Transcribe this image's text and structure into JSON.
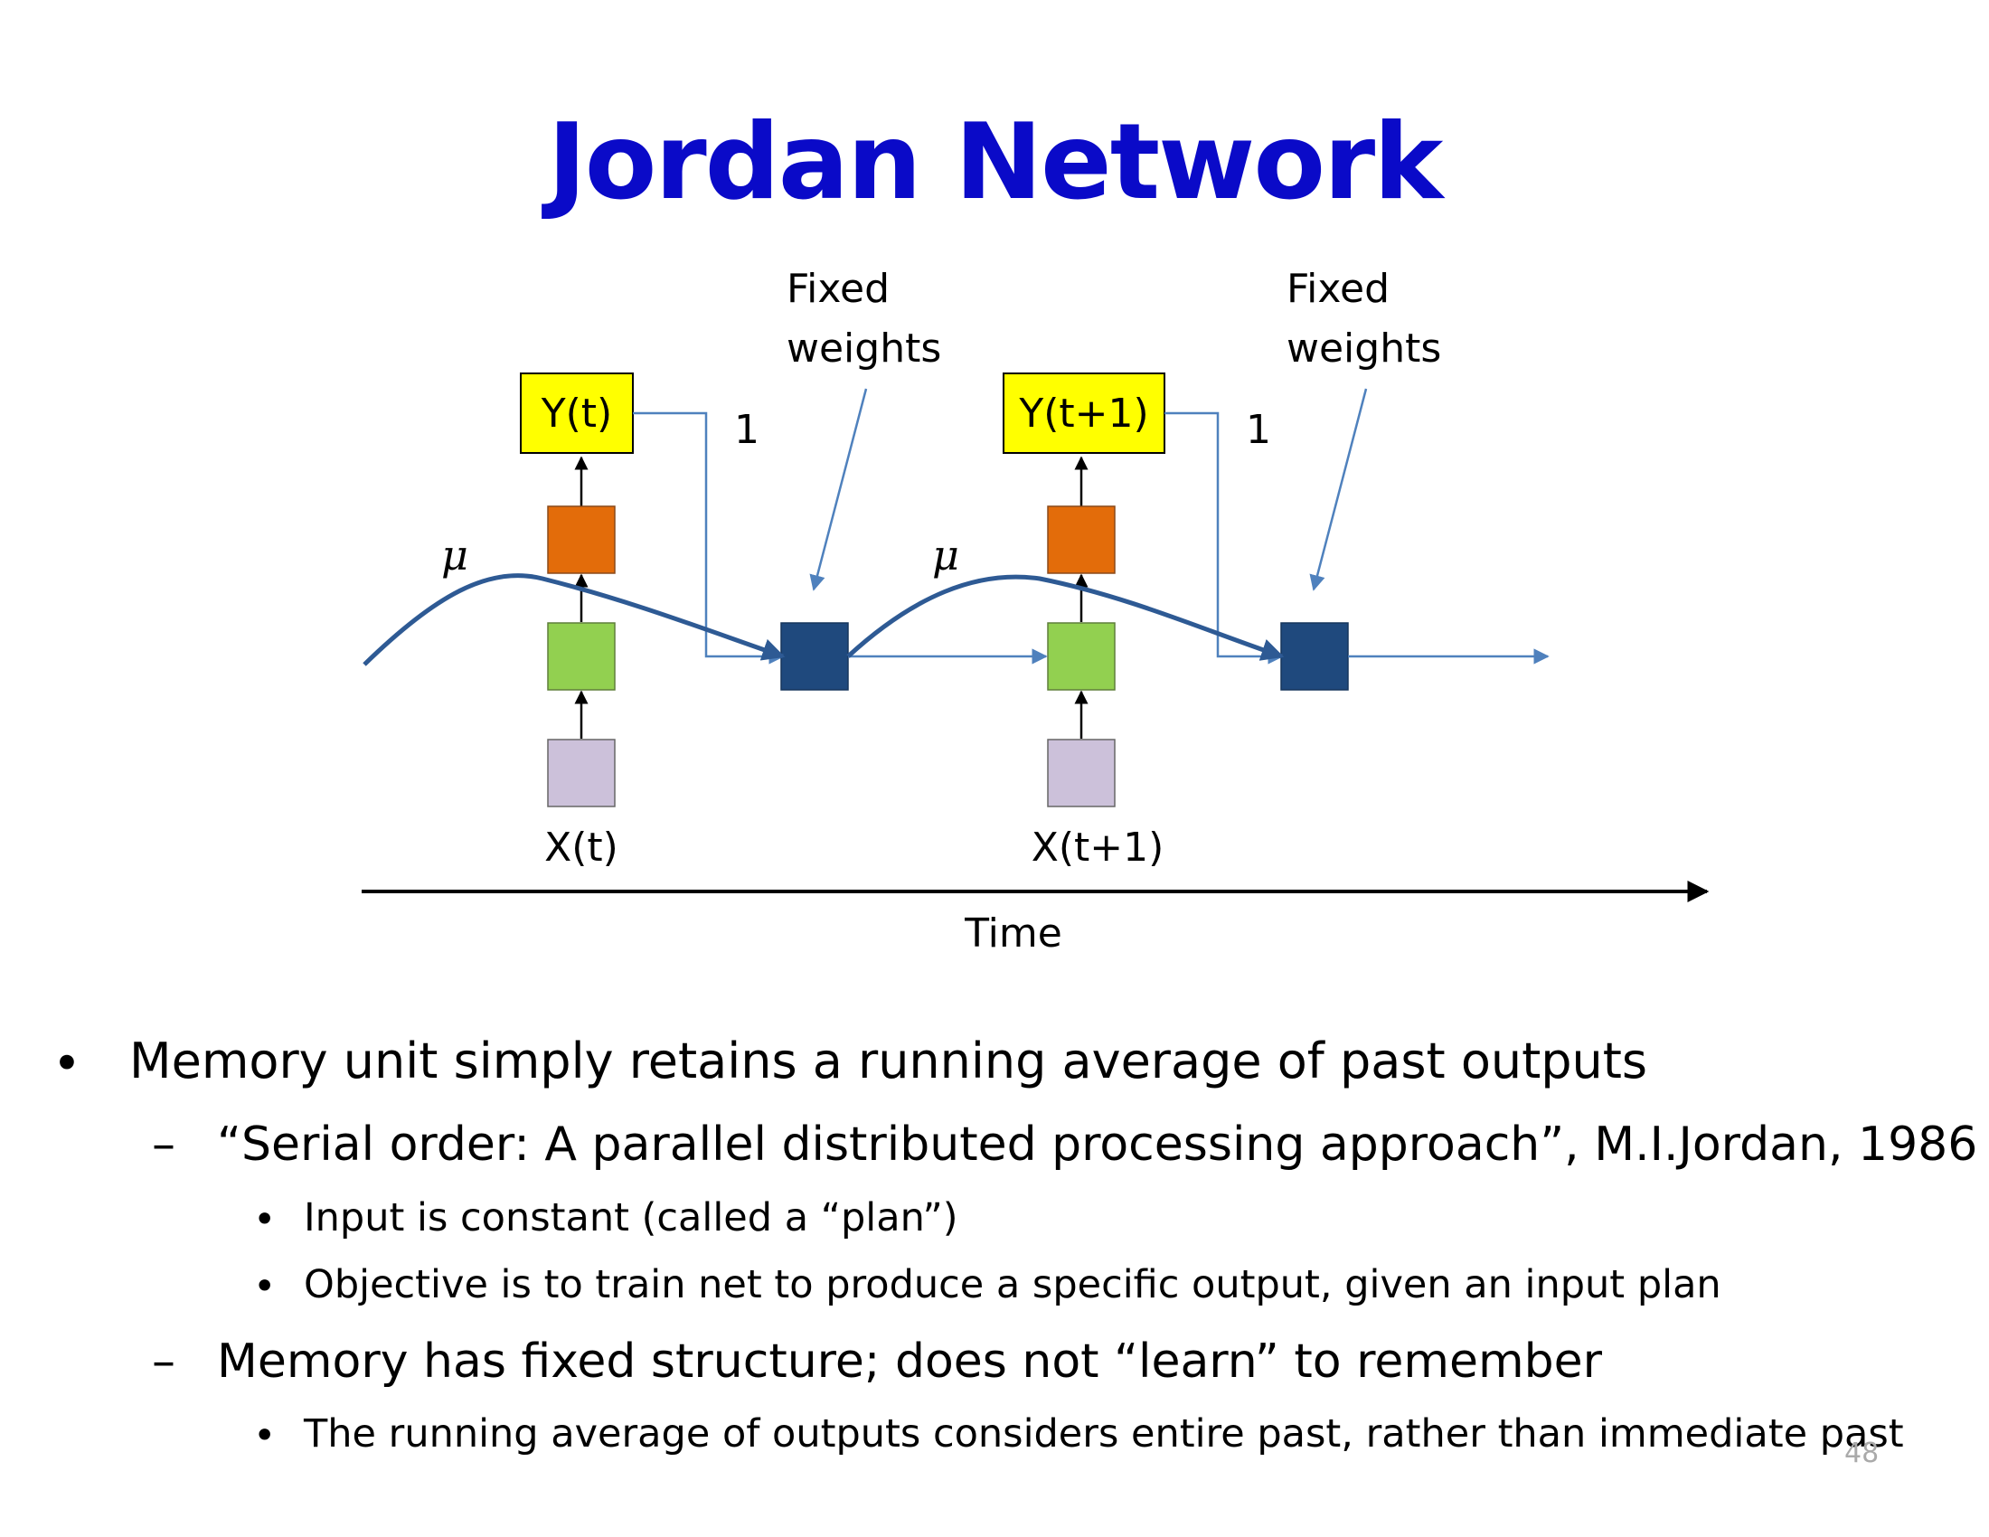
{
  "slide": {
    "title": "Jordan Network",
    "page_number": "48"
  },
  "diagram": {
    "fixed_weights_label_1": "Fixed",
    "fixed_weights_label_1b": "weights",
    "fixed_weights_label_2": "Fixed",
    "fixed_weights_label_2b": "weights",
    "output_1": "Y(t)",
    "output_2": "Y(t+1)",
    "weight_1": "1",
    "weight_2": "1",
    "mu_1": "μ",
    "mu_2": "μ",
    "input_1": "X(t)",
    "input_2": "X(t+1)",
    "time_axis": "Time",
    "colors": {
      "output_box": "#ffff00",
      "hidden_orange": "#e36c0a",
      "hidden_green": "#92d050",
      "input_lavender": "#ccc1da",
      "memory_unit": "#1f497d",
      "connection": "#4f81bd",
      "curve": "#2e5a94"
    }
  },
  "bullets": {
    "b1": "Memory unit simply retains a running average of past outputs",
    "b1_1": "“Serial order: A parallel distributed processing approach”, M.I.Jordan, 1986",
    "b1_1_1": "Input is constant (called a “plan”)",
    "b1_1_2": "Objective is to train net to produce a specific output, given an input plan",
    "b1_2": "Memory has fixed structure; does not “learn” to remember",
    "b1_2_1": "The running average of outputs considers entire past, rather than immediate past",
    "marker_bullet": "•",
    "marker_dash": "–"
  }
}
